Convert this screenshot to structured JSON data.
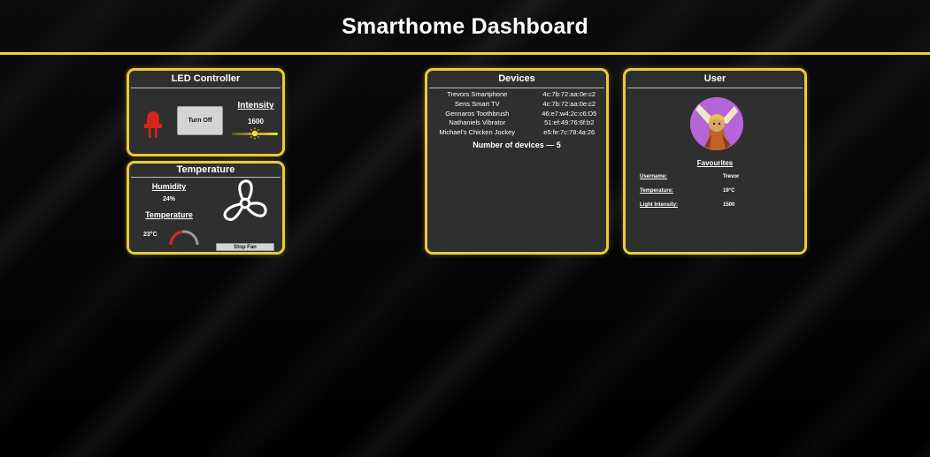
{
  "header": {
    "title": "Smarthome Dashboard"
  },
  "colors": {
    "accent": "#e9cb3a",
    "card_bg": "#2f2f2f",
    "led_red": "#d8241f"
  },
  "led_controller": {
    "title": "LED Controller",
    "icon": "led-icon",
    "toggle_label": "Turn Off",
    "intensity_label": "Intensity",
    "intensity_value": "1600",
    "slider_icon": "sun-icon",
    "slider_level_fraction": 0.5
  },
  "temperature": {
    "title": "Temperature",
    "humidity_label": "Humidity",
    "humidity_value": "24%",
    "temperature_label": "Temperature",
    "temperature_value": "23°C",
    "gauge_fraction": 0.46,
    "fan_icon": "fan-icon",
    "fan_button_label": "Stop Fan"
  },
  "devices": {
    "title": "Devices",
    "items": [
      {
        "name": "Trevors Smartphone",
        "mac": "4c:7b:72:aa:0e:c2"
      },
      {
        "name": "Sens Smart TV",
        "mac": "4c:7b:72:aa:0e:c2"
      },
      {
        "name": "Gennaros Toothbrush",
        "mac": "46:e7:w4:2c:c6:D5"
      },
      {
        "name": "Nathaniels Vibrator",
        "mac": "51:ef:49:76:6f:b2"
      },
      {
        "name": "Michael's Chicken Jockey",
        "mac": "e5:fe:7c:78:4a:26"
      }
    ],
    "count_label": "Number of devices — 5"
  },
  "user": {
    "title": "User",
    "avatar_icon": "avatar-image",
    "favourites_title": "Favourites",
    "favourites": [
      {
        "key": "Username:",
        "value": "Trevor"
      },
      {
        "key": "Temperature:",
        "value": "19°C"
      },
      {
        "key": "Light Intensity:",
        "value": "1500"
      }
    ]
  }
}
